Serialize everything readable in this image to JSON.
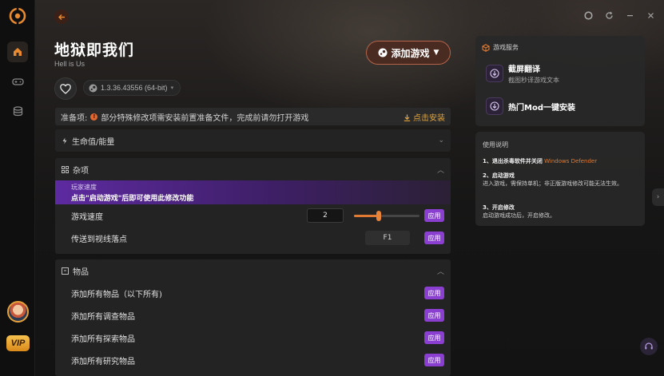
{
  "header": {
    "title": "地狱即我们",
    "subtitle": "Hell is Us",
    "version": "1.3.36.43556 (64-bit)",
    "add_game_label": "添加游戏"
  },
  "prep": {
    "label": "准备项:",
    "notice": "部分特殊修改项需安装前置准备文件，完成前请勿打开游戏",
    "install_label": "点击安装"
  },
  "sections": {
    "health": {
      "title": "生命值/能量"
    },
    "misc": {
      "title": "杂项",
      "banner_title": "玩家速度",
      "banner_text": "点击\"启动游戏\"后即可使用此修改功能",
      "rows": [
        {
          "label": "游戏速度",
          "value": "2",
          "slider_fraction": 0.38,
          "apply": "应用"
        },
        {
          "label": "传送到视线落点",
          "hotkey": "F1",
          "apply": "应用"
        }
      ]
    },
    "items": {
      "title": "物品",
      "rows": [
        {
          "label": "添加所有物品（以下所有)",
          "apply": "应用"
        },
        {
          "label": "添加所有调查物品",
          "apply": "应用"
        },
        {
          "label": "添加所有探索物品",
          "apply": "应用"
        },
        {
          "label": "添加所有研究物品",
          "apply": "应用"
        }
      ]
    }
  },
  "services": {
    "title": "游戏服务",
    "items": [
      {
        "name": "截屏翻译",
        "desc": "截图秒译游戏文本"
      },
      {
        "name": "热门Mod一键安装",
        "desc": ""
      }
    ]
  },
  "usage": {
    "title": "使用说明",
    "step1_title": "1、退出杀毒软件并关闭",
    "step1_highlight": "Windows Defender",
    "step2_title": "2、启动游戏",
    "step2_text": "进入游戏，需保持单机；非正版游戏修改可能无法生效。",
    "step3_title": "3、开启修改",
    "step3_text": "启动游戏成功后，开启修改。"
  },
  "sidebar": {
    "vip_label": "VIP"
  },
  "colors": {
    "accent": "#e07a32",
    "apply": "#8a3fd1",
    "background": "#141414"
  }
}
